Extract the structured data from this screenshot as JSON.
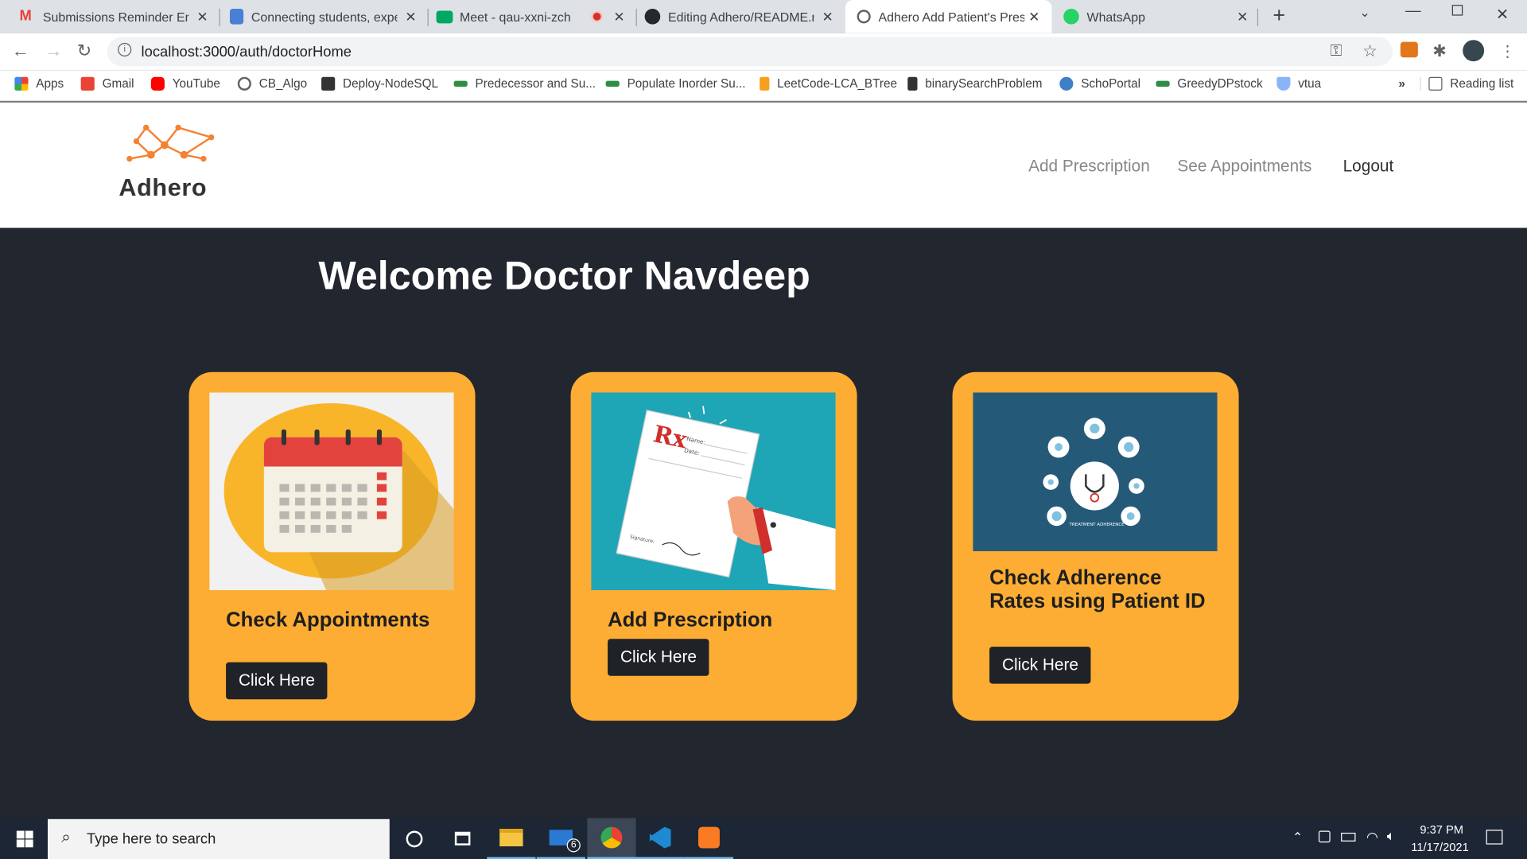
{
  "browser": {
    "tabs": [
      {
        "title": "Submissions Reminder Ema",
        "favicon": "gmail-icon"
      },
      {
        "title": "Connecting students, exper",
        "favicon": "docs-icon"
      },
      {
        "title": "Meet - qau-xxni-zch",
        "favicon": "meet-icon"
      },
      {
        "title": "Editing Adhero/README.m",
        "favicon": "github-icon"
      },
      {
        "title": "Adhero Add Patient's Presc",
        "favicon": "globe-icon",
        "active": true
      },
      {
        "title": "WhatsApp",
        "favicon": "whatsapp-icon"
      }
    ],
    "url": "localhost:3000/auth/doctorHome",
    "bookmarks": [
      "Apps",
      "Gmail",
      "YouTube",
      "CB_Algo",
      "Deploy-NodeSQL",
      "Predecessor and Su...",
      "Populate Inorder Su...",
      "LeetCode-LCA_BTree",
      "binarySearchProblem",
      "SchoPortal",
      "GreedyDPstock",
      "vtua"
    ],
    "bookmarks_overflow": "»",
    "reading_list": "Reading list"
  },
  "app": {
    "logo_text": "Adhero",
    "nav": [
      "Add Prescription",
      "See Appointments",
      "Logout"
    ],
    "welcome": "Welcome Doctor Navdeep",
    "cards": [
      {
        "title": "Check Appointments",
        "button": "Click Here",
        "image": "calendar-illustration"
      },
      {
        "title": "Add Prescription",
        "button": "Click Here",
        "image": "prescription-illustration"
      },
      {
        "title": "Check Adherence Rates using Patient ID",
        "button": "Click Here",
        "image": "treatment-adherence-illustration",
        "image_caption": "TREATMENT ADHERENCE"
      }
    ]
  },
  "rx": {
    "mark": "Rx",
    "name": "Name:",
    "date": "Date:",
    "signature": "Signature:"
  },
  "taskbar": {
    "search_placeholder": "Type here to search",
    "mail_badge": "6",
    "time": "9:37 PM",
    "date": "11/17/2021"
  },
  "colors": {
    "card": "#fdad33",
    "background": "#22262f",
    "button": "#1f2226"
  }
}
